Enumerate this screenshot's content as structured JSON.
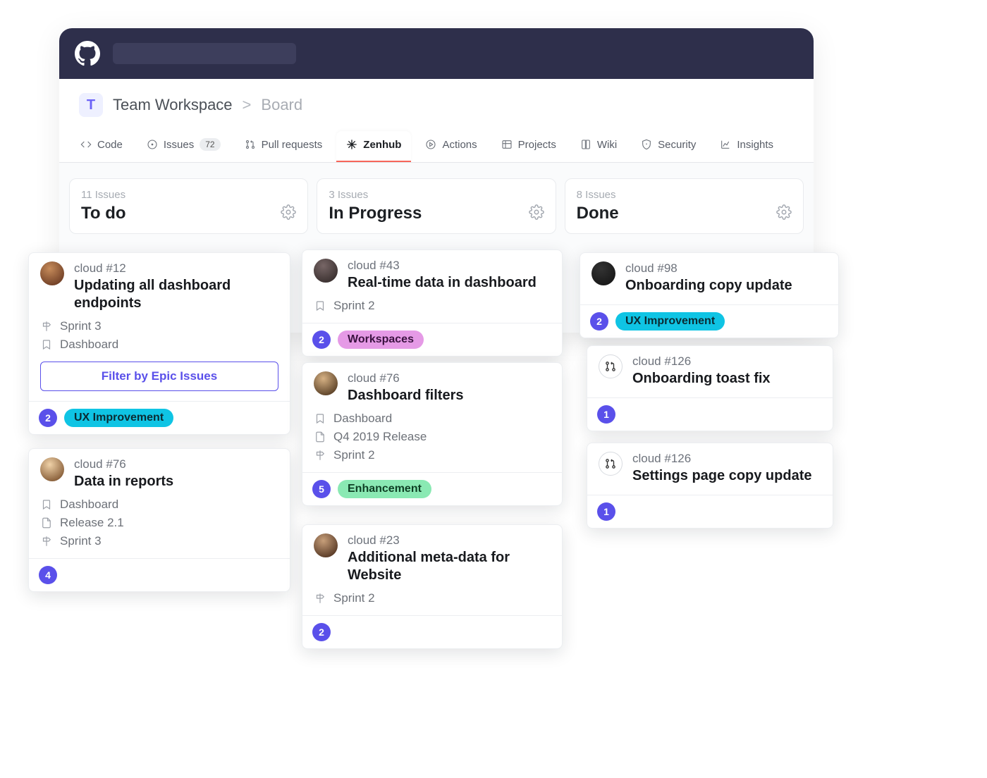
{
  "breadcrumb": {
    "badge_letter": "T",
    "workspace": "Team Workspace",
    "separator": ">",
    "current": "Board"
  },
  "tabs": {
    "code": "Code",
    "issues": "Issues",
    "issues_count": "72",
    "pulls": "Pull requests",
    "zenhub": "Zenhub",
    "actions": "Actions",
    "projects": "Projects",
    "wiki": "Wiki",
    "security": "Security",
    "insights": "Insights"
  },
  "pipelines": {
    "todo": {
      "count": "11 Issues",
      "title": "To do"
    },
    "progress": {
      "count": "3 Issues",
      "title": "In Progress"
    },
    "done": {
      "count": "8 Issues",
      "title": "Done"
    }
  },
  "cards": {
    "c1": {
      "ref": "cloud #12",
      "title": "Updating all dashboard endpoints",
      "sprint": "Sprint 3",
      "epic": "Dashboard",
      "filter_label": "Filter by Epic Issues",
      "estimate": "2",
      "label": "UX Improvement"
    },
    "c2": {
      "ref": "cloud #76",
      "title": "Data in reports",
      "epic": "Dashboard",
      "release": "Release 2.1",
      "sprint": "Sprint 3",
      "estimate": "4"
    },
    "c3": {
      "ref": "cloud #43",
      "title": "Real-time data in dashboard",
      "sprint": "Sprint 2",
      "estimate": "2",
      "label": "Workspaces"
    },
    "c4": {
      "ref": "cloud #76",
      "title": "Dashboard filters",
      "epic": "Dashboard",
      "release": "Q4 2019 Release",
      "sprint": "Sprint 2",
      "estimate": "5",
      "label": "Enhancement"
    },
    "c5": {
      "ref": "cloud #23",
      "title": "Additional meta-data for Website",
      "sprint": "Sprint 2",
      "estimate": "2"
    },
    "c6": {
      "ref": "cloud #98",
      "title": "Onboarding copy update",
      "estimate": "2",
      "label": "UX Improvement"
    },
    "c7": {
      "ref": "cloud #126",
      "title": "Onboarding toast fix",
      "estimate": "1"
    },
    "c8": {
      "ref": "cloud #126",
      "title": "Settings page copy update",
      "estimate": "1"
    }
  }
}
